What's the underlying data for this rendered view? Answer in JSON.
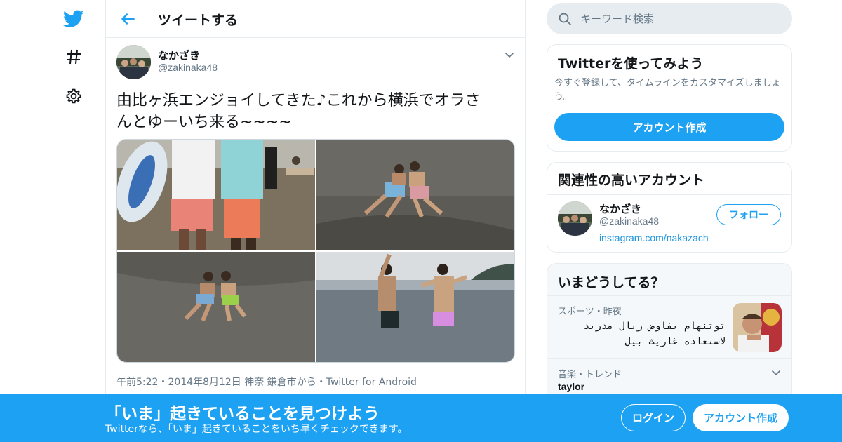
{
  "colors": {
    "accent": "#1da1f2",
    "text": "#14171a",
    "muted": "#657786",
    "border": "#e6ecf0"
  },
  "nav": {
    "logo_icon": "twitter-bird-icon",
    "explore_icon": "hashtag-icon",
    "settings_icon": "gear-icon"
  },
  "header": {
    "title": "ツイートする",
    "back_icon": "back-arrow-icon"
  },
  "tweet": {
    "author_name": "なかざき",
    "author_handle": "@zakinaka48",
    "text_line1": "由比ヶ浜エンジョイしてきた♪これから横浜でオラさ",
    "text_line2": "んとゆーいち来る~~~~",
    "photos_count": 4,
    "meta": {
      "time": "午前5:22",
      "date": "2014年8月12日",
      "location": "神奈 鎌倉市から",
      "source": "Twitter for Android",
      "separator": "・"
    }
  },
  "search": {
    "placeholder": "キーワード検索",
    "icon": "search-icon"
  },
  "signup_card": {
    "title": "Twitterを使ってみよう",
    "description": "今すぐ登録して、タイムラインをカスタマイズしましょう。",
    "button": "アカウント作成"
  },
  "related_card": {
    "title": "関連性の高いアカウント",
    "name": "なかざき",
    "handle": "@zakinaka48",
    "link": "instagram.com/nakazach",
    "follow_button": "フォロー"
  },
  "trends_card": {
    "title": "いまどうしてる？",
    "items": [
      {
        "category": "スポーツ・昨夜",
        "text_line1": "توتنهام يفاوض ريال مدريد",
        "text_line2": "لاستعادة غاريث بيل"
      },
      {
        "category": "音楽・トレンド",
        "text": "taylor"
      }
    ]
  },
  "banner": {
    "title": "「いま」起きていることを見つけよう",
    "subtitle": "Twitterなら、「いま」起きていることをいち早くチェックできます。",
    "login": "ログイン",
    "signup": "アカウント作成"
  }
}
